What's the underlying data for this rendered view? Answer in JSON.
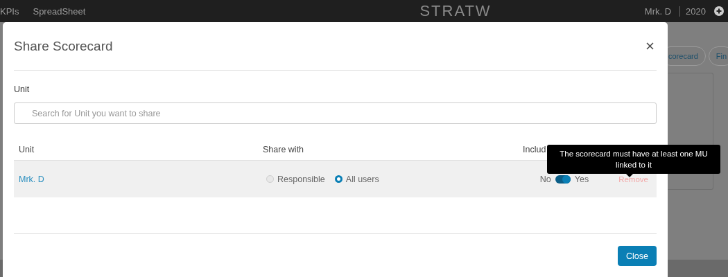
{
  "navbar": {
    "items": [
      "KPIs",
      "SpreadSheet"
    ],
    "logo": "STRATW",
    "user": "Mrk. D",
    "year": "2020"
  },
  "background": {
    "buttons": [
      "corecard",
      "Fin"
    ]
  },
  "modal": {
    "title": "Share Scorecard",
    "unit_label": "Unit",
    "search": {
      "placeholder": "Search for Unit you want to share"
    },
    "columns": [
      "Unit",
      "Share with",
      "Includ"
    ],
    "rows": [
      {
        "unit": "Mrk. D",
        "options": [
          {
            "label": "Responsible",
            "selected": false
          },
          {
            "label": "All users",
            "selected": true
          }
        ],
        "toggle": {
          "off_label": "No",
          "on_label": "Yes",
          "on": true
        },
        "remove": {
          "label": "Remove",
          "disabled": true
        }
      }
    ],
    "tooltip": "The scorecard must have at least one MU linked to it",
    "close_button": "Close"
  }
}
